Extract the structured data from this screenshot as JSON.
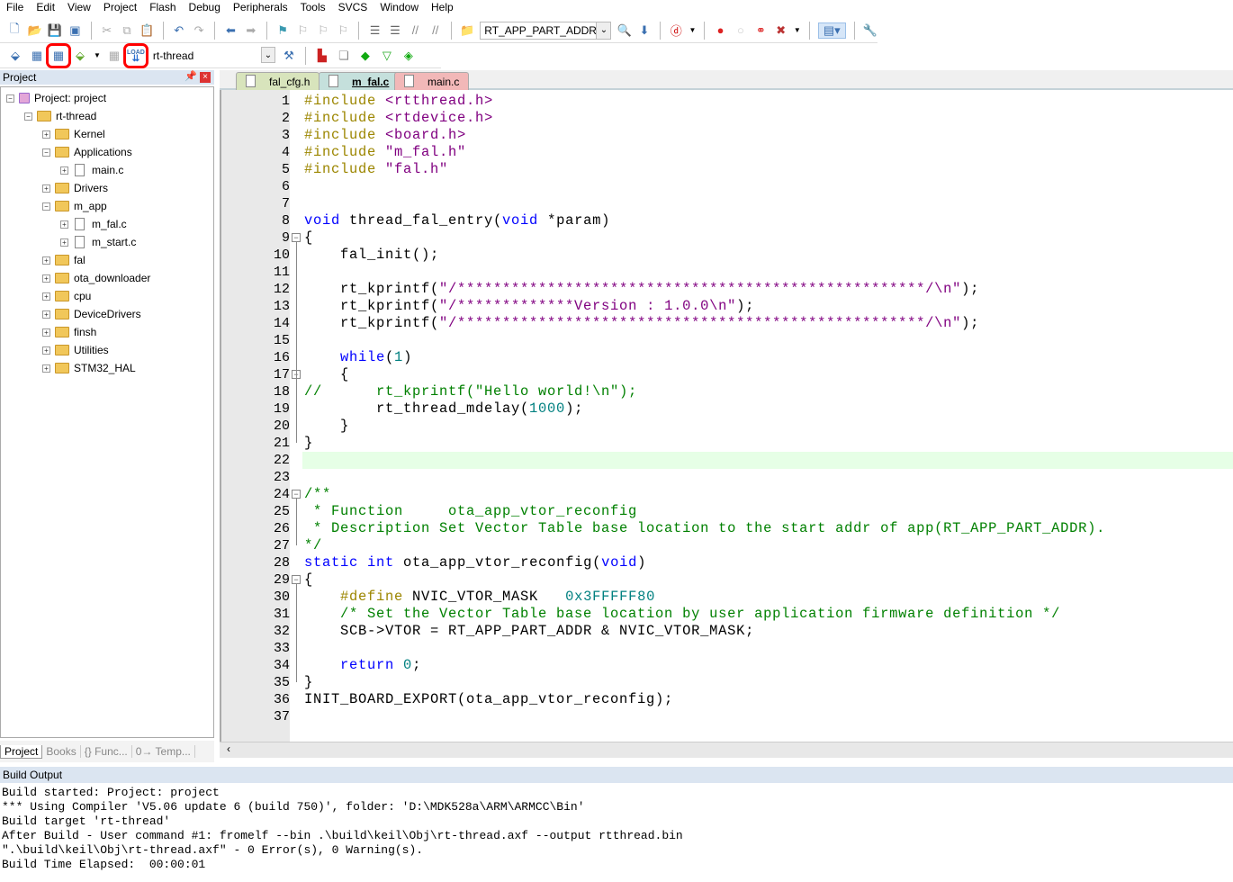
{
  "menu": [
    "File",
    "Edit",
    "View",
    "Project",
    "Flash",
    "Debug",
    "Peripherals",
    "Tools",
    "SVCS",
    "Window",
    "Help"
  ],
  "toolbar1": {
    "find_combo": "RT_APP_PART_ADDR"
  },
  "toolbar2": {
    "target_combo": "rt-thread",
    "highlighted": [
      "batch-build",
      "download-load"
    ],
    "highlight_color": "#ff0000"
  },
  "project_panel": {
    "title": "Project",
    "tree": [
      {
        "label": "Project: project",
        "level": 0,
        "type": "project",
        "exp": "-"
      },
      {
        "label": "rt-thread",
        "level": 1,
        "type": "target",
        "exp": "-"
      },
      {
        "label": "Kernel",
        "level": 2,
        "type": "folder",
        "exp": "+"
      },
      {
        "label": "Applications",
        "level": 2,
        "type": "folder",
        "exp": "-"
      },
      {
        "label": "main.c",
        "level": 3,
        "type": "file",
        "exp": "+"
      },
      {
        "label": "Drivers",
        "level": 2,
        "type": "folder",
        "exp": "+"
      },
      {
        "label": "m_app",
        "level": 2,
        "type": "folder",
        "exp": "-"
      },
      {
        "label": "m_fal.c",
        "level": 3,
        "type": "file",
        "exp": "+"
      },
      {
        "label": "m_start.c",
        "level": 3,
        "type": "file",
        "exp": "+"
      },
      {
        "label": "fal",
        "level": 2,
        "type": "folder",
        "exp": "+"
      },
      {
        "label": "ota_downloader",
        "level": 2,
        "type": "folder",
        "exp": "+"
      },
      {
        "label": "cpu",
        "level": 2,
        "type": "folder",
        "exp": "+"
      },
      {
        "label": "DeviceDrivers",
        "level": 2,
        "type": "folder",
        "exp": "+"
      },
      {
        "label": "finsh",
        "level": 2,
        "type": "folder",
        "exp": "+"
      },
      {
        "label": "Utilities",
        "level": 2,
        "type": "folder",
        "exp": "+"
      },
      {
        "label": "STM32_HAL",
        "level": 2,
        "type": "folder",
        "exp": "+"
      }
    ],
    "tabs": [
      "Project",
      "Books",
      "{} Func...",
      "0→ Temp..."
    ]
  },
  "editor_tabs": [
    {
      "label": "fal_cfg.h",
      "color": "#d8e4bc"
    },
    {
      "label": "m_fal.c",
      "color": "#c5e0dc",
      "active": true
    },
    {
      "label": "main.c",
      "color": "#f2b8b8"
    }
  ],
  "current_line": 22,
  "code": [
    [
      [
        "#include ",
        "pp"
      ],
      [
        "<rtthread.h>",
        "st"
      ]
    ],
    [
      [
        "#include ",
        "pp"
      ],
      [
        "<rtdevice.h>",
        "st"
      ]
    ],
    [
      [
        "#include ",
        "pp"
      ],
      [
        "<board.h>",
        "st"
      ]
    ],
    [
      [
        "#include ",
        "pp"
      ],
      [
        "\"m_fal.h\"",
        "st"
      ]
    ],
    [
      [
        "#include ",
        "pp"
      ],
      [
        "\"fal.h\"",
        "st"
      ]
    ],
    [],
    [],
    [
      [
        "void",
        "kw"
      ],
      [
        " thread_fal_entry(",
        "pl"
      ],
      [
        "void",
        "kw"
      ],
      [
        " *param)",
        "pl"
      ]
    ],
    [
      [
        "{",
        "pl"
      ]
    ],
    [
      [
        "    fal_init();",
        "pl"
      ]
    ],
    [],
    [
      [
        "    rt_kprintf(",
        "pl"
      ],
      [
        "\"/****************************************************/\\n\"",
        "st"
      ],
      [
        ");",
        "pl"
      ]
    ],
    [
      [
        "    rt_kprintf(",
        "pl"
      ],
      [
        "\"/*************Version : 1.0.0\\n\"",
        "st"
      ],
      [
        ");",
        "pl"
      ]
    ],
    [
      [
        "    rt_kprintf(",
        "pl"
      ],
      [
        "\"/****************************************************/\\n\"",
        "st"
      ],
      [
        ");",
        "pl"
      ]
    ],
    [],
    [
      [
        "    ",
        "pl"
      ],
      [
        "while",
        "kw"
      ],
      [
        "(",
        "pl"
      ],
      [
        "1",
        "nm"
      ],
      [
        ")",
        "pl"
      ]
    ],
    [
      [
        "    {",
        "pl"
      ]
    ],
    [
      [
        "//      rt_kprintf(\"Hello world!\\n\");",
        "cm"
      ]
    ],
    [
      [
        "        rt_thread_mdelay(",
        "pl"
      ],
      [
        "1000",
        "nm"
      ],
      [
        ");",
        "pl"
      ]
    ],
    [
      [
        "    }",
        "pl"
      ]
    ],
    [
      [
        "}",
        "pl"
      ]
    ],
    [],
    [],
    [
      [
        "/**",
        "cm"
      ]
    ],
    [
      [
        " * Function     ota_app_vtor_reconfig",
        "cm"
      ]
    ],
    [
      [
        " * Description Set Vector Table base location to the start addr of app(RT_APP_PART_ADDR).",
        "cm"
      ]
    ],
    [
      [
        "*/",
        "cm"
      ]
    ],
    [
      [
        "static",
        "kw"
      ],
      [
        " ",
        "pl"
      ],
      [
        "int",
        "kw"
      ],
      [
        " ota_app_vtor_reconfig(",
        "pl"
      ],
      [
        "void",
        "kw"
      ],
      [
        ")",
        "pl"
      ]
    ],
    [
      [
        "{",
        "pl"
      ]
    ],
    [
      [
        "    ",
        "pl"
      ],
      [
        "#define",
        "pp"
      ],
      [
        " NVIC_VTOR_MASK   ",
        "pl"
      ],
      [
        "0x3FFFFF80",
        "nm"
      ]
    ],
    [
      [
        "    /* Set the Vector Table base location by user application firmware definition */",
        "cm"
      ]
    ],
    [
      [
        "    SCB->VTOR = RT_APP_PART_ADDR & NVIC_VTOR_MASK;",
        "pl"
      ]
    ],
    [],
    [
      [
        "    ",
        "pl"
      ],
      [
        "return",
        "kw"
      ],
      [
        " ",
        "pl"
      ],
      [
        "0",
        "nm"
      ],
      [
        ";",
        "pl"
      ]
    ],
    [
      [
        "}",
        "pl"
      ]
    ],
    [
      [
        "INIT_BOARD_EXPORT(ota_app_vtor_reconfig);",
        "pl"
      ]
    ],
    []
  ],
  "fold_lines": [
    9,
    17,
    24,
    29
  ],
  "build_output": {
    "title": "Build Output",
    "lines": [
      "Build started: Project: project",
      "*** Using Compiler 'V5.06 update 6 (build 750)', folder: 'D:\\MDK528a\\ARM\\ARMCC\\Bin'",
      "Build target 'rt-thread'",
      "After Build - User command #1: fromelf --bin .\\build\\keil\\Obj\\rt-thread.axf --output rtthread.bin",
      "\".\\build\\keil\\Obj\\rt-thread.axf\" - 0 Error(s), 0 Warning(s).",
      "Build Time Elapsed:  00:00:01"
    ]
  }
}
